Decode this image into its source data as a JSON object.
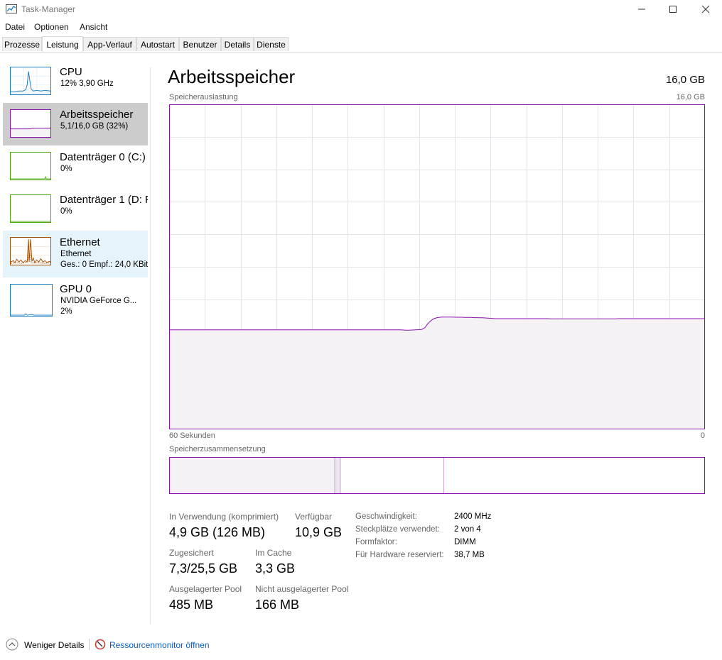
{
  "window": {
    "title": "Task-Manager",
    "buttons": [
      "minimize",
      "maximize",
      "close"
    ]
  },
  "menu": [
    "Datei",
    "Optionen",
    "Ansicht"
  ],
  "tabs": [
    "Prozesse",
    "Leistung",
    "App-Verlauf",
    "Autostart",
    "Benutzer",
    "Details",
    "Dienste"
  ],
  "active_tab": "Leistung",
  "sidebar": {
    "items": [
      {
        "title": "CPU",
        "sub1": "12%  3,90 GHz",
        "sub2": "",
        "color": "#1a7cc2"
      },
      {
        "title": "Arbeitsspeicher",
        "sub1": "5,1/16,0 GB (32%)",
        "sub2": "",
        "color": "#8b12ae"
      },
      {
        "title": "Datenträger 0 (C:)",
        "sub1": "0%",
        "sub2": "",
        "color": "#4da60c"
      },
      {
        "title": "Datenträger 1 (D: F",
        "sub1": "0%",
        "sub2": "",
        "color": "#4da60c"
      },
      {
        "title": "Ethernet",
        "sub1": "Ethernet",
        "sub2": "Ges.: 0 Empf.: 24,0 KBit/",
        "color": "#a74f01"
      },
      {
        "title": "GPU 0",
        "sub1": "NVIDIA GeForce G...",
        "sub2": "2%",
        "color": "#1a7cc2"
      }
    ]
  },
  "main": {
    "title": "Arbeitsspeicher",
    "total": "16,0 GB",
    "graph": {
      "label": "Speicherauslastung",
      "max_label": "16,0 GB",
      "time_left": "60 Sekunden",
      "time_right": "0",
      "accent": "#8b12ae",
      "fill": "#f4f2f4",
      "usage_series": [
        4.9,
        4.9,
        4.9,
        4.9,
        4.9,
        4.9,
        4.9,
        4.9,
        4.9,
        4.9,
        4.9,
        4.9,
        4.9,
        4.9,
        4.9,
        4.9,
        4.9,
        4.9,
        4.9,
        4.9,
        4.9,
        4.9,
        4.9,
        4.9,
        4.9,
        4.9,
        4.9,
        4.9,
        4.9,
        4.9,
        4.9,
        4.9,
        4.9,
        4.9,
        4.9,
        4.9,
        4.9,
        4.9,
        4.9,
        4.9,
        4.9,
        4.9,
        4.9,
        4.9,
        4.9,
        4.9,
        4.9,
        4.9,
        4.9,
        4.9,
        4.9,
        4.9,
        4.9,
        4.9,
        4.9,
        4.9,
        4.9,
        4.9,
        4.9,
        4.9,
        4.9,
        4.9,
        4.9,
        4.9,
        4.9,
        4.9,
        4.9,
        4.9,
        4.9,
        4.9,
        4.9,
        4.9,
        4.9,
        4.9,
        4.9,
        4.9,
        4.89,
        4.88,
        4.88,
        4.89,
        4.9,
        4.91,
        4.92,
        5.0,
        5.2,
        5.35,
        5.45,
        5.5,
        5.52,
        5.53,
        5.53,
        5.53,
        5.53,
        5.52,
        5.52,
        5.52,
        5.51,
        5.51,
        5.51,
        5.5,
        5.5,
        5.49,
        5.49,
        5.48,
        5.47,
        5.46,
        5.45,
        5.45,
        5.45,
        5.45,
        5.45,
        5.45,
        5.45,
        5.45,
        5.45,
        5.45,
        5.45,
        5.45,
        5.45,
        5.45,
        5.45,
        5.45,
        5.45,
        5.45,
        5.44,
        5.44,
        5.44,
        5.44,
        5.44,
        5.44,
        5.44,
        5.44,
        5.44,
        5.44,
        5.44,
        5.44,
        5.44,
        5.44,
        5.44,
        5.44,
        5.44,
        5.44,
        5.44,
        5.44,
        5.44,
        5.44,
        5.45,
        5.45,
        5.45,
        5.45,
        5.45,
        5.45,
        5.45,
        5.45,
        5.45,
        5.45,
        5.45,
        5.45,
        5.45,
        5.45,
        5.45,
        5.45,
        5.45,
        5.45,
        5.45,
        5.45,
        5.45,
        5.45,
        5.45,
        5.45,
        5.45,
        5.45,
        5.45,
        5.45,
        5.45
      ]
    },
    "composition": {
      "label": "Speicherzusammensetzung"
    },
    "stats": {
      "in_use_label": "In Verwendung (komprimiert)",
      "in_use_value": "4,9 GB (126 MB)",
      "available_label": "Verfügbar",
      "available_value": "10,9 GB",
      "committed_label": "Zugesichert",
      "committed_value": "7,3/25,5 GB",
      "cached_label": "Im Cache",
      "cached_value": "3,3 GB",
      "paged_label": "Ausgelagerter Pool",
      "paged_value": "485 MB",
      "nonpaged_label": "Nicht ausgelagerter Pool",
      "nonpaged_value": "166 MB"
    },
    "specs": [
      {
        "label": "Geschwindigkeit:",
        "value": "2400 MHz"
      },
      {
        "label": "Steckplätze verwendet:",
        "value": "2 von 4"
      },
      {
        "label": "Formfaktor:",
        "value": "DIMM"
      },
      {
        "label": "Für Hardware reserviert:",
        "value": "38,7 MB"
      }
    ]
  },
  "footer": {
    "less_details": "Weniger Details",
    "resource_monitor": "Ressourcenmonitor öffnen"
  }
}
